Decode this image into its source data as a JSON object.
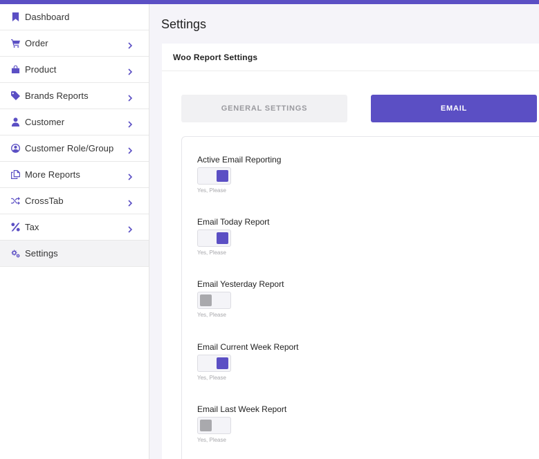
{
  "sidebar": {
    "items": [
      {
        "label": "Dashboard",
        "icon": "bookmark-icon",
        "has_chevron": false
      },
      {
        "label": "Order",
        "icon": "cart-icon",
        "has_chevron": true
      },
      {
        "label": "Product",
        "icon": "shopping-bag-icon",
        "has_chevron": true
      },
      {
        "label": "Brands Reports",
        "icon": "tag-icon",
        "has_chevron": true
      },
      {
        "label": "Customer",
        "icon": "user-icon",
        "has_chevron": true
      },
      {
        "label": "Customer Role/Group",
        "icon": "user-circle-icon",
        "has_chevron": true
      },
      {
        "label": "More Reports",
        "icon": "copy-icon",
        "has_chevron": true
      },
      {
        "label": "CrossTab",
        "icon": "shuffle-icon",
        "has_chevron": true
      },
      {
        "label": "Tax",
        "icon": "percent-icon",
        "has_chevron": true
      },
      {
        "label": "Settings",
        "icon": "gears-icon",
        "has_chevron": false,
        "active": true
      }
    ]
  },
  "page": {
    "title": "Settings",
    "card_title": "Woo Report Settings"
  },
  "tabs": {
    "general": "GENERAL SETTINGS",
    "email": "EMAIL",
    "active": "email"
  },
  "settings": [
    {
      "label": "Active Email Reporting",
      "enabled": true,
      "hint": "Yes, Please"
    },
    {
      "label": "Email Today Report",
      "enabled": true,
      "hint": "Yes, Please"
    },
    {
      "label": "Email Yesterday Report",
      "enabled": false,
      "hint": "Yes, Please"
    },
    {
      "label": "Email Current Week Report",
      "enabled": true,
      "hint": "Yes, Please"
    },
    {
      "label": "Email Last Week Report",
      "enabled": false,
      "hint": "Yes, Please"
    }
  ],
  "colors": {
    "accent": "#5b4fc4",
    "toggle_off": "#a9a9ad"
  }
}
